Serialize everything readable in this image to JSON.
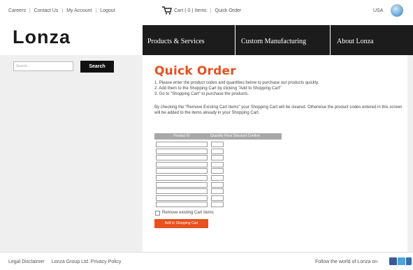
{
  "top_links": [
    "Careers",
    "Contact Us",
    "My Account",
    "Logout"
  ],
  "cart": {
    "cart_text": "Cart ( 0 ) Items",
    "quick_order": "Quick Order"
  },
  "country": "USA",
  "logo_text": "Lonza",
  "nav": [
    "Products & Services",
    "Custom Manufacturing",
    "About Lonza"
  ],
  "search": {
    "placeholder": "Search...",
    "button": "Search"
  },
  "main": {
    "title": "Quick Order",
    "steps": [
      "1. Please enter the product codes and quantities below to purchase our products quickly.",
      "2. Add them to the Shopping Cart by clicking \"Add to Shopping Cart\"",
      "3. Go to \"Shopping Cart\" to purchase the products."
    ],
    "note": "By checking the \"Remove Existing Cart Items\" your Shopping Cart will be cleared. Otherwise the product codes entered in this screen will be added to the items already in your Shopping Cart.",
    "table_headers": [
      "Product ID",
      "Quantity Price Discount Confirm"
    ],
    "row_count": 10,
    "remove_label": "Remove existing Cart Items",
    "add_button": "Add to Shopping Cart"
  },
  "footer": {
    "links": [
      "Legal Disclaimer",
      "Lonza Group Ltd. Privacy Policy"
    ],
    "follow": "Follow the world of Lonza on"
  },
  "colors": {
    "accent": "#e8501e",
    "nav_bg": "#1c1c1c",
    "sidebar_bg": "#efefef"
  }
}
